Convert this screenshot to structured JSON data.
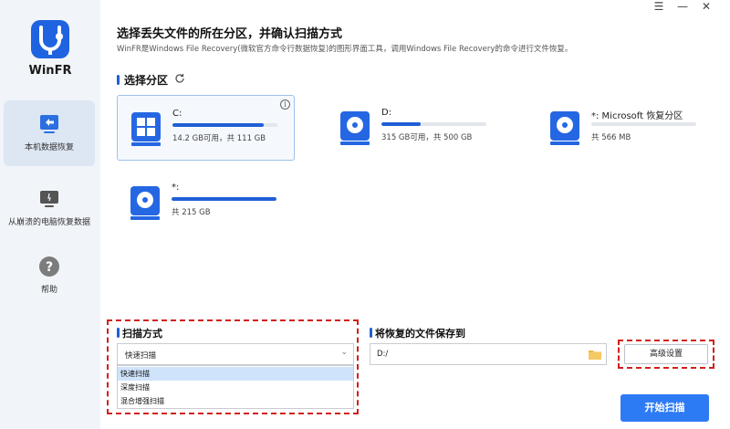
{
  "app": {
    "name": "WinFR"
  },
  "window": {
    "menu_icon": "menu-icon",
    "minimize_icon": "minimize-icon",
    "close_icon": "close-icon"
  },
  "sidebar": {
    "items": [
      {
        "label": "本机数据恢复",
        "icon": "restore-icon",
        "active": true
      },
      {
        "label": "从崩溃的电脑恢复数据",
        "icon": "monitor-icon",
        "active": false
      },
      {
        "label": "帮助",
        "icon": "help-icon",
        "active": false
      }
    ]
  },
  "header": {
    "title": "选择丢失文件的所在分区，并确认扫描方式",
    "subtitle": "WinFR是Windows File Recovery(微软官方命令行数据恢复)的图形界面工具，调用Windows File Recovery的命令进行文件恢复。"
  },
  "partition_section": {
    "title": "选择分区",
    "refresh_icon": "refresh-icon"
  },
  "drives": [
    {
      "name": "C:",
      "info": "14.2 GB可用，共 111 GB",
      "used_fraction": 0.87,
      "icon": "windows-drive-icon",
      "selected": true
    },
    {
      "name": "D:",
      "info": "315 GB可用，共 500 GB",
      "used_fraction": 0.37,
      "icon": "disk-icon",
      "selected": false
    },
    {
      "name": "*: Microsoft 恢复分区",
      "info": "共 566 MB",
      "used_fraction": 0,
      "icon": "disk-icon",
      "selected": false
    },
    {
      "name": "*:",
      "info": "共 215 GB",
      "used_fraction": 1.0,
      "icon": "disk-icon",
      "selected": false
    }
  ],
  "scan": {
    "title": "扫描方式",
    "selected": "快速扫描",
    "options": [
      "快速扫描",
      "深度扫描",
      "混合增强扫描"
    ]
  },
  "save": {
    "title": "将恢复的文件保存到",
    "path": "D:/"
  },
  "buttons": {
    "advanced": "高级设置",
    "start": "开始扫描"
  },
  "colors": {
    "accent": "#1f5fd6",
    "start_button": "#2d7bf4",
    "highlight": "#d0201c",
    "sidebar_bg": "#f1f4f8"
  }
}
